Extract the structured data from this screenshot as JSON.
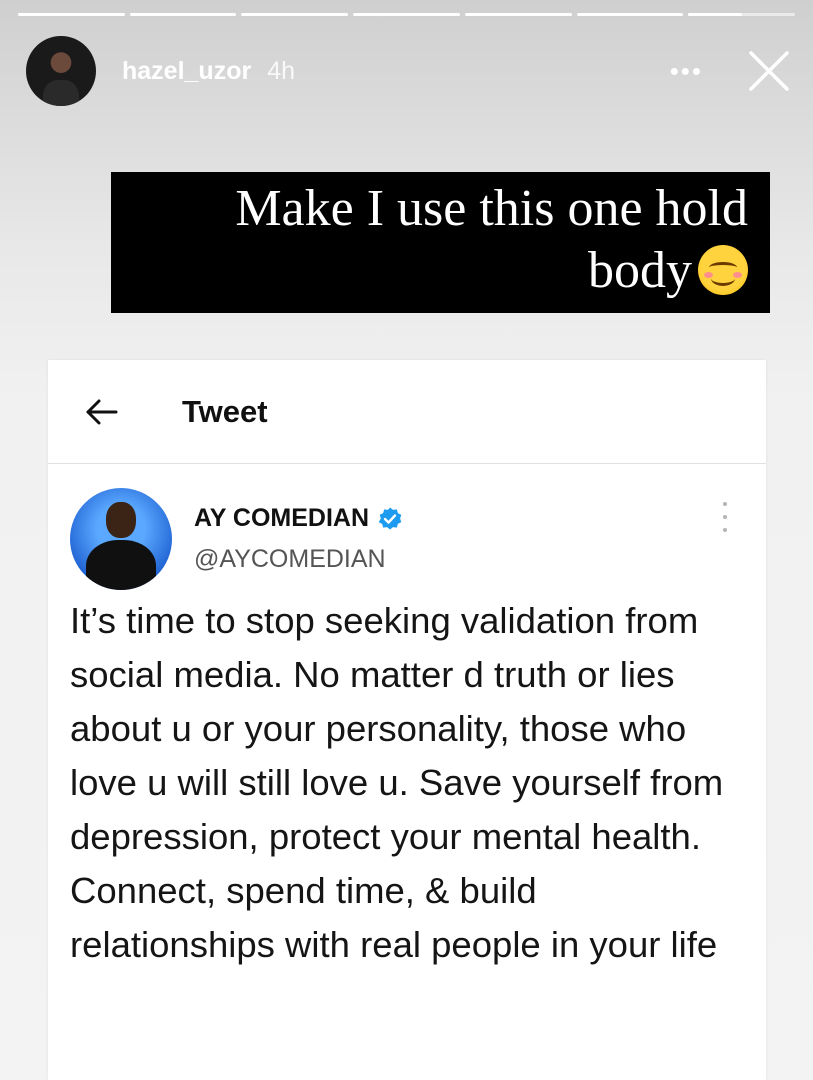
{
  "story": {
    "username": "hazel_uzor",
    "time": "4h",
    "more_label": "•••",
    "segments": [
      {
        "progress": 1
      },
      {
        "progress": 1
      },
      {
        "progress": 1
      },
      {
        "progress": 1
      },
      {
        "progress": 1
      },
      {
        "progress": 1
      },
      {
        "progress": 0.5
      }
    ],
    "icons": {
      "avatar": "profile-avatar",
      "close": "close-icon",
      "more": "more-icon"
    }
  },
  "caption": {
    "text": "Make I use this one hold body",
    "emoji": "smiling-face-emoji"
  },
  "tweet_card": {
    "title": "Tweet",
    "back_icon": "back-arrow-icon",
    "author_name": "AY COMEDIAN",
    "author_handle": "@AYCOMEDIAN",
    "verified_icon": "verified-badge-icon",
    "verified_color": "#1d9bf0",
    "menu_icon": "vertical-dots-icon",
    "body": "It’s time to stop seeking validation from social media. No matter d truth or lies about u or your personality, those who love u will still love u. Save yourself from depression, protect your mental health. Connect, spend time, & build relationships with real people in your life"
  }
}
